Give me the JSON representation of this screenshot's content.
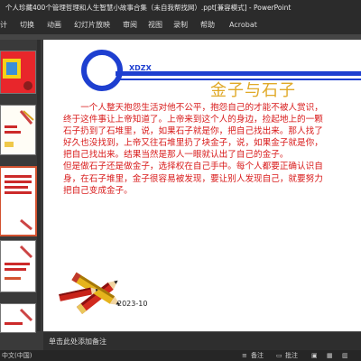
{
  "window": {
    "title": "个人珍藏400个管理哲理和人生智慧小故事合集（未自我帮找网）.ppt[兼容模式] - PowerPoint"
  },
  "ribbon": {
    "tabs": [
      "计",
      "切换",
      "动画",
      "幻灯片放映",
      "审阅",
      "视图",
      "录制",
      "帮助",
      "Acrobat"
    ]
  },
  "slide": {
    "logo": "XDZX",
    "title": "金子与石子",
    "paragraphs": [
      "一个人整天抱怨生活对他不公平，抱怨自己的才能不被人赏识，终于这件事让上帝知道了。上帝来到这个人的身边，捡起地上的一颗石子扔到了石堆里，说，如果石子就是你，把自己找出来。那人找了好久也没找到，上帝又往石堆里扔了块金子，说，如果金子就是你，把自己找出来。结果当然是那人一眼就认出了自己的金子。",
      "但是做石子还是做金子，选择权在自己手中。每个人都要正确认识自身，在石子堆里，金子很容易被发现，要让别人发现自己，就要努力把自己变成金子。"
    ],
    "date": "2023-10"
  },
  "notes": {
    "placeholder": "单击此处添加备注"
  },
  "statusbar": {
    "language": "中文(中国)",
    "notes_label": "备注",
    "comments_label": "批注"
  },
  "colors": {
    "accent": "#d35230",
    "ring_blue": "#1e3fd0",
    "title_gold": "#e0a928",
    "body_red": "#d81a1a"
  }
}
